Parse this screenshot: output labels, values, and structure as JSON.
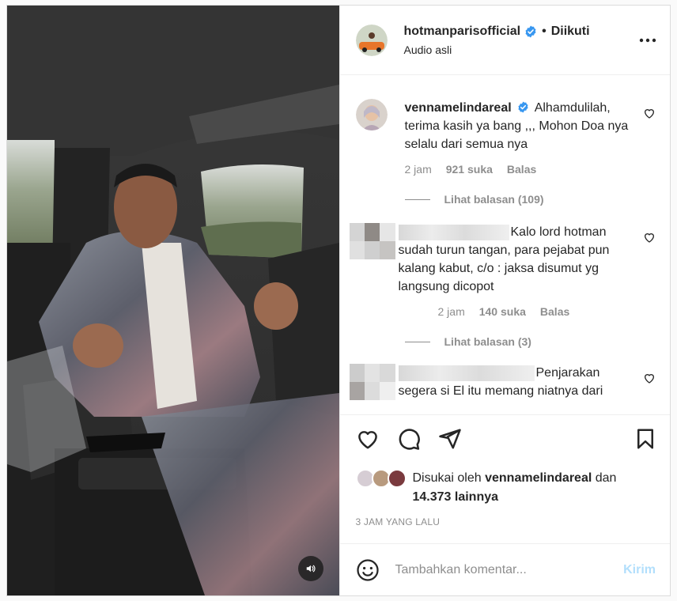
{
  "post": {
    "author": "hotmanparisofficial",
    "verified": true,
    "separator": "•",
    "follow_status": "Diikuti",
    "audio": "Audio asli",
    "more_label": "•••"
  },
  "comments": [
    {
      "username": "vennamelindareal",
      "verified": true,
      "text": "Alhamdulilah, terima kasih ya bang ,,, Mohon Doa nya selalu dari semua nya",
      "time": "2 jam",
      "likes": "921 suka",
      "reply": "Balas",
      "view_replies": "Lihat balasan (109)"
    },
    {
      "username": "",
      "text": "Kalo lord hotman sudah turun tangan, para pejabat pun kalang kabut, c/o : jaksa disumut yg langsung dicopot",
      "time": "2 jam",
      "likes": "140 suka",
      "reply": "Balas",
      "view_replies": "Lihat balasan (3)"
    },
    {
      "username": "",
      "text": "Penjarakan segera si El itu memang niatnya dari"
    }
  ],
  "liked_by": {
    "prefix": "Disukai oleh",
    "user": "vennamelindareal",
    "connector": "dan",
    "others": "14.373 lainnya"
  },
  "timestamp": "3 JAM YANG LALU",
  "composer": {
    "placeholder": "Tambahkan komentar...",
    "send_label": "Kirim"
  },
  "colors": {
    "verified_blue": "#3897f0",
    "send_disabled": "#b2dffc",
    "muted": "#8e8e8e"
  },
  "icons": [
    "like-icon",
    "comment-icon",
    "share-icon",
    "save-icon",
    "emoji-icon",
    "sound-icon",
    "more-icon",
    "heart-small-icon",
    "verified-icon"
  ]
}
